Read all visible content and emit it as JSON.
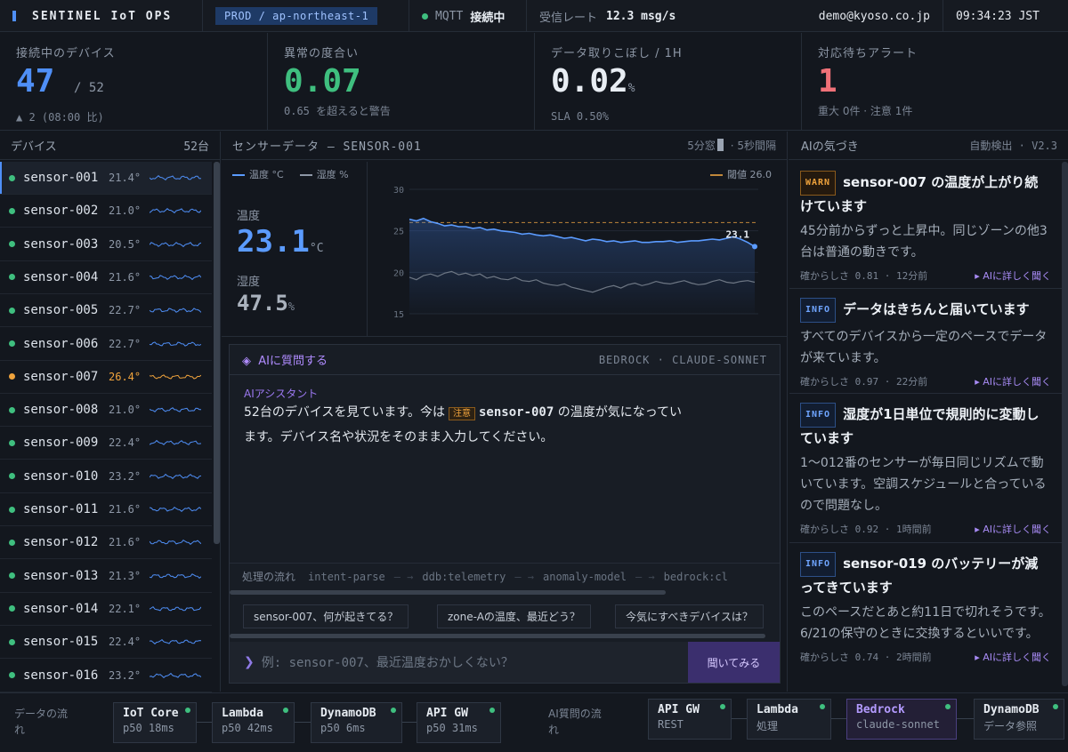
{
  "header": {
    "brand": "SENTINEL IoT OPS",
    "env": "PROD / ap-northeast-1",
    "mqtt_label": "MQTT",
    "mqtt_status": "接続中",
    "rate_label": "受信レート",
    "rate_value": "12.3 msg/s",
    "user": "demo@kyoso.co.jp",
    "clock": "09:34:23 JST"
  },
  "kpis": [
    {
      "label": "接続中のデバイス",
      "value": "47",
      "suffix": "/ 52",
      "sub": "▲ 2 (08:00 比)",
      "color": "#4f8ff7"
    },
    {
      "label": "異常の度合い",
      "value": "0.07",
      "suffix": "",
      "sub": "0.65 を超えると警告",
      "color": "#3fbf7f"
    },
    {
      "label": "データ取りこぼし / 1H",
      "value": "0.02",
      "suffix": "%",
      "sub": "SLA 0.50%",
      "color": "#e8edf3"
    },
    {
      "label": "対応待ちアラート",
      "value": "1",
      "suffix": "",
      "sub": "重大 0件 · 注意 1件",
      "color": "#f07178"
    }
  ],
  "devices": {
    "title": "デバイス",
    "count": "52台",
    "items": [
      {
        "name": "sensor-001",
        "temp": "21.4°",
        "status": "ok"
      },
      {
        "name": "sensor-002",
        "temp": "21.0°",
        "status": "ok"
      },
      {
        "name": "sensor-003",
        "temp": "20.5°",
        "status": "ok"
      },
      {
        "name": "sensor-004",
        "temp": "21.6°",
        "status": "ok"
      },
      {
        "name": "sensor-005",
        "temp": "22.7°",
        "status": "ok"
      },
      {
        "name": "sensor-006",
        "temp": "22.7°",
        "status": "ok"
      },
      {
        "name": "sensor-007",
        "temp": "26.4°",
        "status": "warn"
      },
      {
        "name": "sensor-008",
        "temp": "21.0°",
        "status": "ok"
      },
      {
        "name": "sensor-009",
        "temp": "22.4°",
        "status": "ok"
      },
      {
        "name": "sensor-010",
        "temp": "23.2°",
        "status": "ok"
      },
      {
        "name": "sensor-011",
        "temp": "21.6°",
        "status": "ok"
      },
      {
        "name": "sensor-012",
        "temp": "21.6°",
        "status": "ok"
      },
      {
        "name": "sensor-013",
        "temp": "21.3°",
        "status": "ok"
      },
      {
        "name": "sensor-014",
        "temp": "22.1°",
        "status": "ok"
      },
      {
        "name": "sensor-015",
        "temp": "22.4°",
        "status": "ok"
      },
      {
        "name": "sensor-016",
        "temp": "23.2°",
        "status": "ok"
      }
    ]
  },
  "sensor_panel": {
    "title": "センサーデータ — SENSOR-001",
    "window": "5分窓",
    "interval": "5秒間隔",
    "legend_temp": "温度 °C",
    "legend_hum": "湿度 %",
    "legend_threshold": "閾値 26.0",
    "temp_label": "温度",
    "temp_value": "23.1",
    "temp_unit": "°C",
    "hum_label": "湿度",
    "hum_value": "47.5",
    "hum_unit": "%",
    "last_point_label": "23.1"
  },
  "chart_data": {
    "type": "line",
    "title": "",
    "xlabel": "",
    "ylabel": "",
    "ylim": [
      15,
      30
    ],
    "yticks": [
      "30",
      "25",
      "20",
      "15"
    ],
    "threshold": 26.0,
    "series": [
      {
        "name": "温度 °C",
        "color": "#5b9bff",
        "values": [
          26.4,
          26.2,
          26.5,
          26.1,
          25.9,
          25.6,
          25.7,
          25.5,
          25.5,
          25.3,
          25.4,
          25.1,
          25.2,
          25.0,
          24.9,
          24.8,
          24.6,
          24.7,
          24.5,
          24.4,
          24.5,
          24.3,
          24.1,
          24.2,
          24.0,
          23.8,
          24.0,
          23.9,
          23.7,
          23.8,
          23.6,
          23.7,
          23.8,
          23.6,
          23.6,
          23.7,
          23.7,
          23.8,
          23.6,
          23.7,
          23.8,
          23.8,
          23.9,
          24.0,
          23.9,
          24.1,
          24.3,
          24.0,
          23.6,
          23.1
        ]
      },
      {
        "name": "湿度 %",
        "color": "#6e7784",
        "values": [
          19.4,
          19.1,
          19.6,
          19.8,
          19.5,
          19.9,
          20.1,
          19.7,
          19.9,
          19.6,
          19.8,
          19.3,
          19.5,
          19.2,
          19.1,
          19.4,
          19.0,
          18.9,
          19.1,
          18.7,
          18.5,
          18.4,
          18.6,
          18.2,
          18.0,
          17.8,
          17.6,
          17.9,
          18.2,
          18.4,
          18.1,
          18.5,
          18.7,
          18.4,
          18.6,
          18.9,
          18.7,
          18.6,
          18.8,
          19.0,
          18.7,
          18.5,
          18.6,
          18.9,
          19.1,
          18.8,
          18.7,
          18.9,
          19.0,
          18.8
        ]
      }
    ]
  },
  "ask": {
    "title": "AIに質問する",
    "model": "BEDROCK · CLAUDE-SONNET",
    "assistant_label": "AIアシスタント",
    "msg_prefix": "52台のデバイスを見ています。今は",
    "chip": "注意",
    "msg_device": "sensor-007",
    "msg_mid": "の温度が気になってい",
    "msg_line2": "ます。デバイス名や状況をそのまま入力してください。",
    "flow_label": "処理の流れ",
    "flow_steps": [
      "intent-parse",
      "ddb:telemetry",
      "anomaly-model",
      "bedrock:cl"
    ],
    "suggestions": [
      "sensor-007、何が起きてる？",
      "zone-Aの温度、最近どう？",
      "今気にすべきデバイスは？"
    ],
    "prompt_symbol": "❯",
    "placeholder": "例: sensor-007、最近温度おかしくない？",
    "button": "聞いてみる"
  },
  "insights": {
    "title": "AIの気づき",
    "meta": "自動検出 · V2.3",
    "cards": [
      {
        "tag": "WARN",
        "title": "sensor-007 の温度が上がり続けています",
        "body": "45分前からずっと上昇中。同じゾーンの他3台は普通の動きです。",
        "confidence": "確からしさ 0.81 · 12分前",
        "link": "▸ AIに詳しく聞く"
      },
      {
        "tag": "INFO",
        "title": "データはきちんと届いています",
        "body": "すべてのデバイスから一定のペースでデータが来ています。",
        "confidence": "確からしさ 0.97 · 22分前",
        "link": "▸ AIに詳しく聞く"
      },
      {
        "tag": "INFO",
        "title": "湿度が1日単位で規則的に変動しています",
        "body": "1〜012番のセンサーが毎日同じリズムで動いています。空調スケジュールと合っているので問題なし。",
        "confidence": "確からしさ 0.92 · 1時間前",
        "link": "▸ AIに詳しく聞く"
      },
      {
        "tag": "INFO",
        "title": "sensor-019 のバッテリーが減ってきています",
        "body": "このペースだとあと約11日で切れそうです。6/21の保守のときに交換するといいです。",
        "confidence": "確からしさ 0.74 · 2時間前",
        "link": "▸ AIに詳しく聞く"
      }
    ]
  },
  "data_flow": {
    "label": "データの流れ",
    "nodes": [
      {
        "name": "IoT Core",
        "meta": "p50 18ms"
      },
      {
        "name": "Lambda",
        "meta": "p50 42ms"
      },
      {
        "name": "DynamoDB",
        "meta": "p50 6ms"
      },
      {
        "name": "API GW",
        "meta": "p50 31ms"
      }
    ]
  },
  "ai_flow": {
    "label": "AI質問の流れ",
    "nodes": [
      {
        "name": "API GW",
        "meta": "REST"
      },
      {
        "name": "Lambda",
        "meta": "処理"
      },
      {
        "name": "Bedrock",
        "meta": "claude-sonnet"
      },
      {
        "name": "DynamoDB",
        "meta": "データ参照"
      }
    ]
  }
}
